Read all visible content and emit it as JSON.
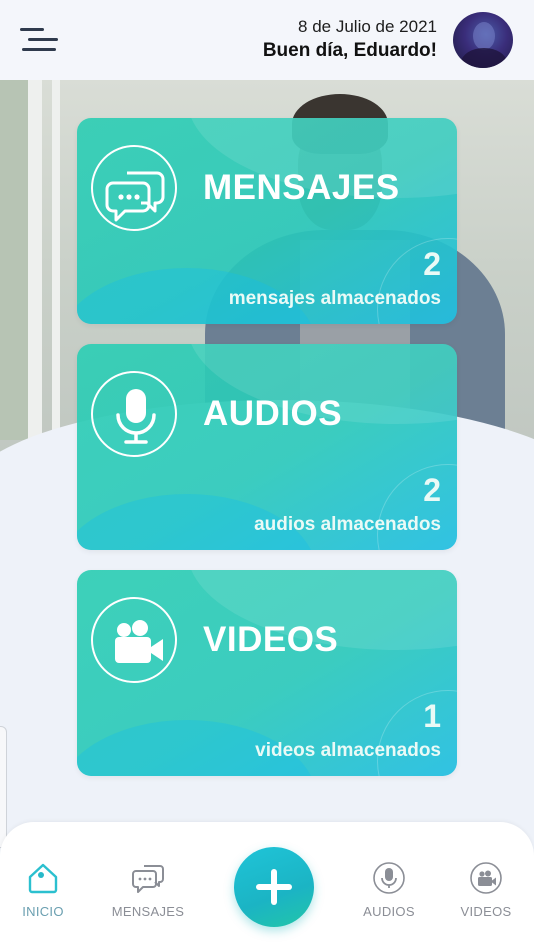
{
  "header": {
    "date": "8 de Julio de 2021",
    "greeting": "Buen día, Eduardo!"
  },
  "cards": [
    {
      "title": "MENSAJES",
      "count": "2",
      "caption": "mensajes almacenados",
      "icon": "chat-bubbles-icon"
    },
    {
      "title": "AUDIOS",
      "count": "2",
      "caption": "audios almacenados",
      "icon": "microphone-icon"
    },
    {
      "title": "VIDEOS",
      "count": "1",
      "caption": "videos almacenados",
      "icon": "video-camera-icon"
    }
  ],
  "bottom_nav": {
    "items": [
      {
        "label": "INICIO",
        "icon": "home-icon",
        "active": true
      },
      {
        "label": "MENSAJES",
        "icon": "chat-bubbles-icon",
        "active": false
      },
      {
        "label": "AUDIOS",
        "icon": "microphone-icon",
        "active": false
      },
      {
        "label": "VIDEOS",
        "icon": "video-camera-icon",
        "active": false
      }
    ],
    "fab_icon": "plus-icon"
  },
  "colors": {
    "accent": "#27b9c9",
    "card_gradient_start": "#30ceb4",
    "card_gradient_end": "#21bee1",
    "text_dark": "#111111",
    "nav_inactive": "#8b8e96"
  }
}
